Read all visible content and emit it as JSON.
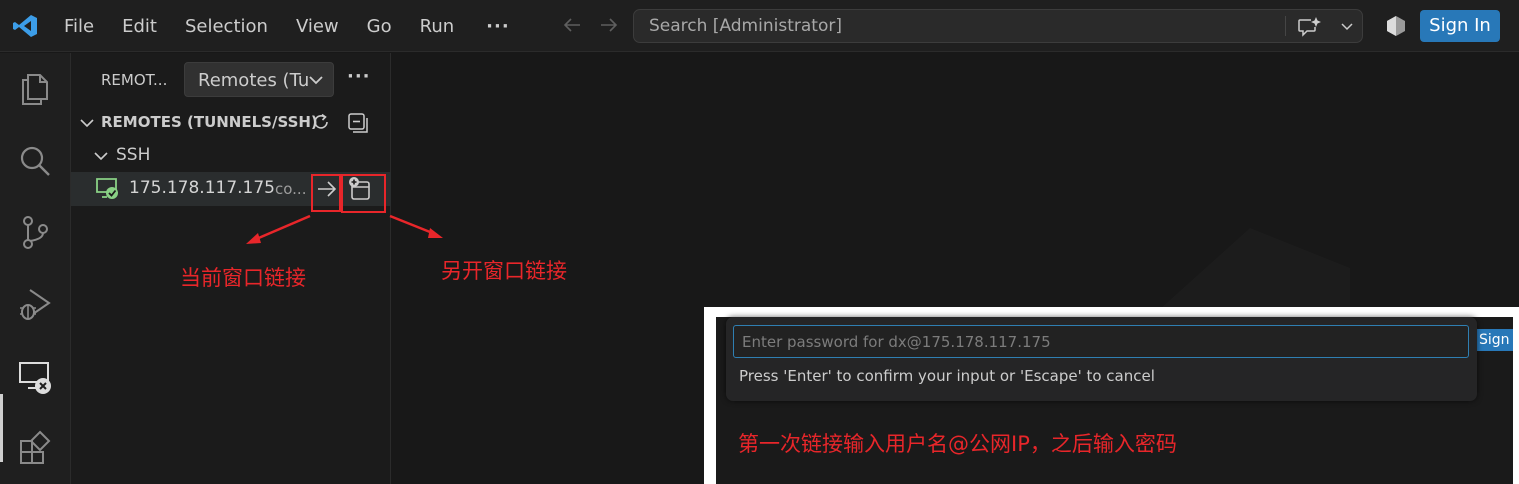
{
  "titlebar": {
    "menu": [
      "File",
      "Edit",
      "Selection",
      "View",
      "Go",
      "Run"
    ],
    "more": "···",
    "search_text": "Search [Administrator]",
    "signin_label": "Sign In",
    "accent_color": "#2878b8"
  },
  "activitybar": {
    "items": [
      "explorer-icon",
      "search-icon",
      "source-control-icon",
      "run-debug-icon",
      "remote-explorer-icon",
      "extensions-icon"
    ],
    "active": "remote-explorer-icon"
  },
  "sidebar": {
    "title": "REMOT...",
    "dropdown_label": "Remotes (Tunnels/SSH)",
    "more": "···",
    "section_label": "REMOTES (TUNNELS/SSH)",
    "group_label": "SSH",
    "host": {
      "ip": "175.178.117.175",
      "status": "co..."
    }
  },
  "annotations": {
    "current_window": "当前窗口链接",
    "new_window": "另开窗口链接",
    "color": "#e8262a"
  },
  "pasted": {
    "sign_fragment": "Sign",
    "password_placeholder": "Enter password for dx@175.178.117.175",
    "hint": "Press 'Enter' to confirm your input or 'Escape' to cancel",
    "note": "第一次链接输入用户名@公网IP，之后输入密码"
  }
}
